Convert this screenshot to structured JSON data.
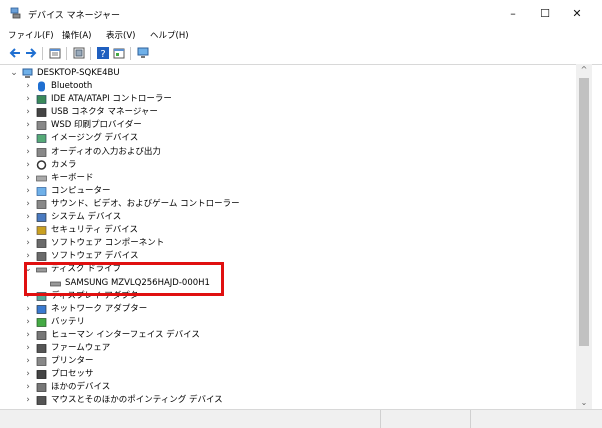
{
  "window": {
    "title": "デバイス マネージャー",
    "minimize_glyph": "–",
    "maximize_glyph": "☐",
    "close_glyph": "✕"
  },
  "menu": {
    "items": [
      "ファイル(F)",
      "操作(A)",
      "表示(V)",
      "ヘルプ(H)"
    ]
  },
  "toolbar": {
    "buttons": [
      "back-arrow-icon",
      "forward-arrow-icon",
      "properties-icon",
      "show-hidden-icon",
      "help-icon",
      "view-icon",
      "monitor-icon"
    ]
  },
  "tree": {
    "root": "DESKTOP-SQKE4BU",
    "items": [
      {
        "label": "Bluetooth",
        "icon": "bluetooth-icon"
      },
      {
        "label": "IDE ATA/ATAPI コントローラー",
        "icon": "ide-controller-icon"
      },
      {
        "label": "USB コネクタ マネージャー",
        "icon": "usb-icon"
      },
      {
        "label": "WSD 印刷プロバイダー",
        "icon": "printer-provider-icon"
      },
      {
        "label": "イメージング デバイス",
        "icon": "camera-device-icon"
      },
      {
        "label": "オーディオの入力および出力",
        "icon": "audio-icon"
      },
      {
        "label": "カメラ",
        "icon": "webcam-icon"
      },
      {
        "label": "キーボード",
        "icon": "keyboard-icon"
      },
      {
        "label": "コンピューター",
        "icon": "computer-icon"
      },
      {
        "label": "サウンド、ビデオ、およびゲーム コントローラー",
        "icon": "sound-icon"
      },
      {
        "label": "システム デバイス",
        "icon": "system-device-icon"
      },
      {
        "label": "セキュリティ デバイス",
        "icon": "security-device-icon"
      },
      {
        "label": "ソフトウェア コンポーネント",
        "icon": "software-component-icon"
      },
      {
        "label": "ソフトウェア デバイス",
        "icon": "software-device-icon"
      },
      {
        "label": "ディスク ドライブ",
        "icon": "disk-drive-icon",
        "expanded": true
      },
      {
        "label": "SAMSUNG MZVLQ256HAJD-000H1",
        "icon": "disk-icon",
        "child": true
      },
      {
        "label": "ディスプレイ アダプター",
        "icon": "display-adapter-icon"
      },
      {
        "label": "ネットワーク アダプター",
        "icon": "network-adapter-icon"
      },
      {
        "label": "バッテリ",
        "icon": "battery-icon"
      },
      {
        "label": "ヒューマン インターフェイス デバイス",
        "icon": "hid-icon"
      },
      {
        "label": "ファームウェア",
        "icon": "firmware-icon"
      },
      {
        "label": "プリンター",
        "icon": "printer-icon"
      },
      {
        "label": "プロセッサ",
        "icon": "processor-icon"
      },
      {
        "label": "ほかのデバイス",
        "icon": "other-device-icon"
      },
      {
        "label": "マウスとそのほかのポインティング デバイス",
        "icon": "mouse-icon"
      }
    ]
  },
  "colors": {
    "highlight_border": "#e01010",
    "accent_blue": "#1f6fd1"
  }
}
